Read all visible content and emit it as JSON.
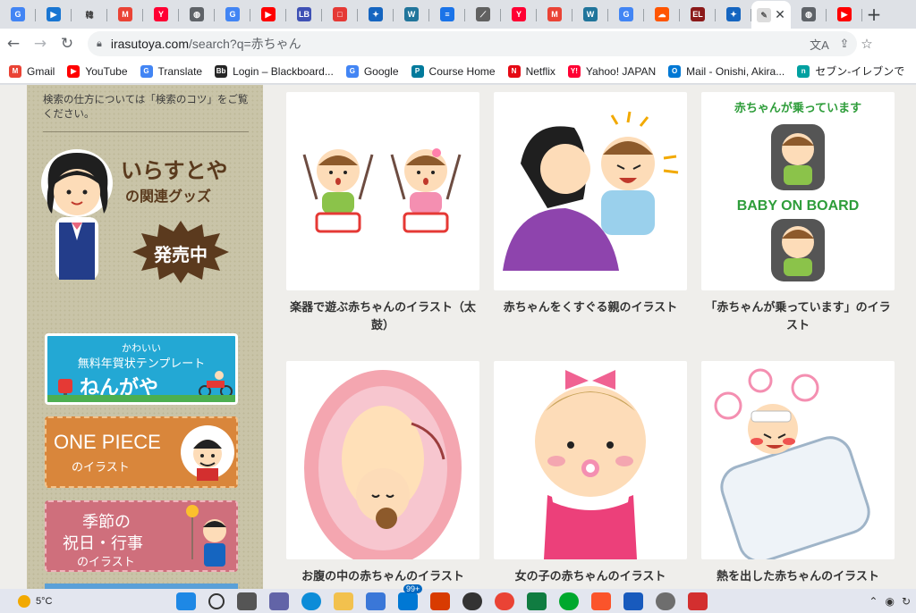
{
  "tabs": [
    {
      "icon": "google-lens-icon",
      "color": "#4285f4",
      "glyph": "G"
    },
    {
      "icon": "bookmark-blue-icon",
      "color": "#1976d2",
      "glyph": "▶"
    },
    {
      "icon": "kanji-page-icon",
      "color": "#ffffff",
      "glyph": "韓"
    },
    {
      "icon": "gmail-icon",
      "color": "#ea4335",
      "glyph": "M"
    },
    {
      "icon": "yahoo-auction-icon",
      "color": "#ff0033",
      "glyph": "Y"
    },
    {
      "icon": "globe-icon",
      "color": "#5f6368",
      "glyph": "◍"
    },
    {
      "icon": "google-icon",
      "color": "#4285f4",
      "glyph": "G"
    },
    {
      "icon": "youtube-icon",
      "color": "#ff0000",
      "glyph": "▶"
    },
    {
      "icon": "lbi-icon",
      "color": "#3f51b5",
      "glyph": "LB"
    },
    {
      "icon": "red-square-icon",
      "color": "#e53935",
      "glyph": "□"
    },
    {
      "icon": "bird-icon",
      "color": "#1565c0",
      "glyph": "✦"
    },
    {
      "icon": "wordpress-icon",
      "color": "#21759b",
      "glyph": "W"
    },
    {
      "icon": "doc-icon",
      "color": "#1a73e8",
      "glyph": "≡"
    },
    {
      "icon": "feather-icon",
      "color": "#616161",
      "glyph": "⟋"
    },
    {
      "icon": "yahoo-auction-icon",
      "color": "#ff0033",
      "glyph": "Y"
    },
    {
      "icon": "gmail-icon",
      "color": "#ea4335",
      "glyph": "M"
    },
    {
      "icon": "wordpress-icon",
      "color": "#21759b",
      "glyph": "W"
    },
    {
      "icon": "google-icon",
      "color": "#4285f4",
      "glyph": "G"
    },
    {
      "icon": "soundcloud-icon",
      "color": "#ff5500",
      "glyph": "☁"
    },
    {
      "icon": "el-icon",
      "color": "#8b1a1a",
      "glyph": "EL"
    },
    {
      "icon": "bird-icon",
      "color": "#1565c0",
      "glyph": "✦"
    }
  ],
  "active_tab": {
    "icon": "irasutoya-icon",
    "close": "✕"
  },
  "after_tabs": [
    {
      "icon": "globe-icon",
      "color": "#5f6368",
      "glyph": "◍"
    },
    {
      "icon": "youtube-icon",
      "color": "#ff0000",
      "glyph": "▶"
    }
  ],
  "new_tab": "+",
  "omnibox": {
    "host": "irasutoya.com",
    "path": "/search?q=赤ちゃん"
  },
  "bookmarks": [
    {
      "label": "Gmail",
      "icon": "gmail-icon",
      "color": "#ea4335",
      "glyph": "M"
    },
    {
      "label": "YouTube",
      "icon": "youtube-icon",
      "color": "#ff0000",
      "glyph": "▶"
    },
    {
      "label": "Translate",
      "icon": "translate-icon",
      "color": "#4285f4",
      "glyph": "G"
    },
    {
      "label": "Login – Blackboard...",
      "icon": "blackboard-icon",
      "color": "#262626",
      "glyph": "Bb"
    },
    {
      "label": "Google",
      "icon": "google-icon",
      "color": "#4285f4",
      "glyph": "G"
    },
    {
      "label": "Course Home",
      "icon": "pearson-icon",
      "color": "#007a9c",
      "glyph": "P"
    },
    {
      "label": "Netflix",
      "icon": "netflix-icon",
      "color": "#e50914",
      "glyph": "N"
    },
    {
      "label": "Yahoo! JAPAN",
      "icon": "yahoo-icon",
      "color": "#ff0033",
      "glyph": "Y!"
    },
    {
      "label": "Mail - Onishi, Akira...",
      "icon": "outlook-icon",
      "color": "#0078d4",
      "glyph": "O"
    },
    {
      "label": "セブン-イレブンで",
      "icon": "seven-net-icon",
      "color": "#00a0a0",
      "glyph": "n"
    }
  ],
  "sidebar": {
    "help_text": "検索の仕方については「検索のコツ」をご覧ください。",
    "goods": {
      "title": "いらすとや",
      "subtitle": "の関連グッズ",
      "badge": "発売中"
    },
    "banner_nengaya": {
      "line1": "かわいい",
      "line2": "無料年賀状テンプレート",
      "line3": "ねんがや"
    },
    "banner_onepiece": {
      "line1": "ONE PIECE",
      "line2": "のイラスト"
    },
    "banner_season": {
      "line1": "季節の",
      "line2": "祝日・行事",
      "line3": "のイラスト"
    }
  },
  "results": [
    {
      "caption": "楽器で遊ぶ赤ちゃんのイラスト（太鼓）"
    },
    {
      "caption": "赤ちゃんをくすぐる親のイラスト"
    },
    {
      "caption": "「赤ちゃんが乗っています」のイラスト",
      "sticker_top": "赤ちゃんが乗っています",
      "sticker_bottom": "BABY ON BOARD"
    },
    {
      "caption": "お腹の中の赤ちゃんのイラスト"
    },
    {
      "caption": "女の子の赤ちゃんのイラスト"
    },
    {
      "caption": "熱を出した赤ちゃんのイラスト"
    }
  ],
  "taskbar": {
    "temperature": "5°C",
    "mail_badge": "99+"
  },
  "colors": {
    "accent": "#1a73e8",
    "sidebar_bg": "#c9c4a8",
    "page_bg": "#efeeeb"
  }
}
